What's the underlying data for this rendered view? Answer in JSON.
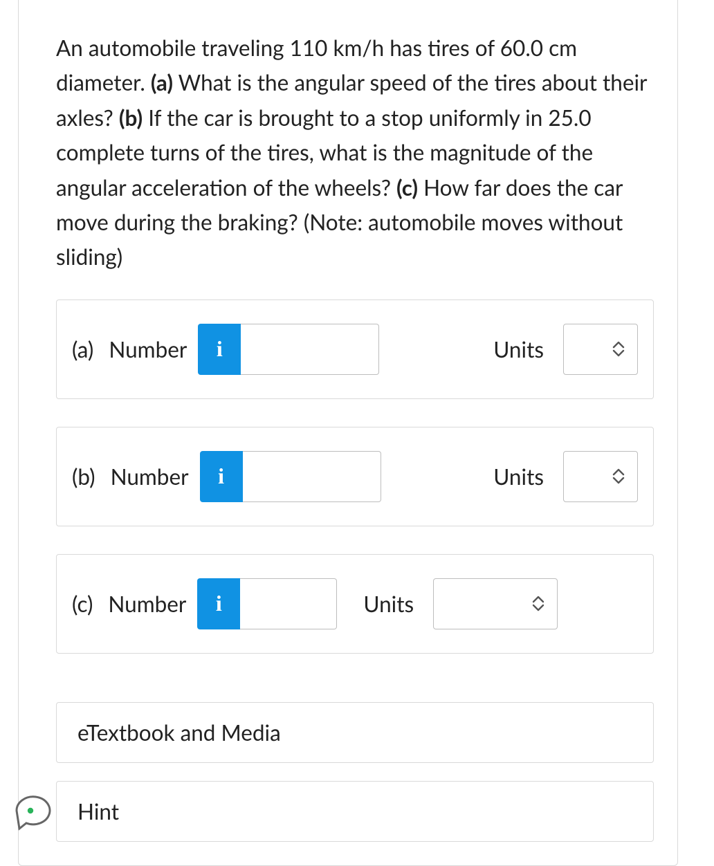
{
  "question": {
    "pre_a": "An automobile traveling 110 km/h has tires of 60.0 cm diameter. ",
    "label_a": "(a)",
    "text_a": " What is the angular speed of the tires about their axles? ",
    "label_b": "(b)",
    "text_b": " If the car is brought to a stop uniformly in 25.0 complete turns of the tires, what is the magnitude of the angular acceleration of the wheels? ",
    "label_c": "(c)",
    "text_c": " How far does the car move during the braking? (Note: automobile moves without sliding)"
  },
  "rows": {
    "a": {
      "part": "(a)",
      "number_label": "Number",
      "info": "i",
      "units_label": "Units"
    },
    "b": {
      "part": "(b)",
      "number_label": "Number",
      "info": "i",
      "units_label": "Units"
    },
    "c": {
      "part": "(c)",
      "number_label": "Number",
      "info": "i",
      "units_label": "Units"
    }
  },
  "buttons": {
    "etextbook": "eTextbook and Media",
    "hint": "Hint"
  }
}
